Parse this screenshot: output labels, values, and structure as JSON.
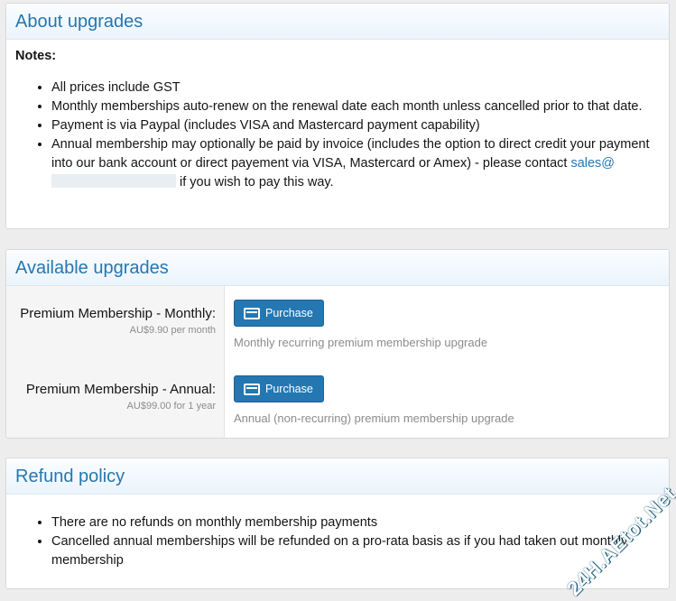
{
  "about": {
    "title": "About upgrades",
    "notes_label": "Notes:",
    "items": [
      "All prices include GST",
      "Monthly memberships auto-renew on the renewal date each month unless cancelled prior to that date.",
      "Payment is via Paypal (includes VISA and Mastercard payment capability)"
    ],
    "annual_text": "Annual membership may optionally be paid by invoice (includes the option to direct credit your payment into our bank account or direct payement via VISA, Mastercard or Amex) - please contact",
    "contact_email": "sales@",
    "annual_suffix": "if you wish to pay this way."
  },
  "available": {
    "title": "Available upgrades",
    "upgrades": [
      {
        "name": "Premium Membership - Monthly:",
        "price": "AU$9.90 per month",
        "button_label": "Purchase",
        "description": "Monthly recurring premium membership upgrade"
      },
      {
        "name": "Premium Membership - Annual:",
        "price": "AU$99.00 for 1 year",
        "button_label": "Purchase",
        "description": "Annual (non-recurring) premium membership upgrade"
      }
    ]
  },
  "refund": {
    "title": "Refund policy",
    "items": [
      "There are no refunds on monthly membership payments",
      "Cancelled annual memberships will be refunded on a pro-rata basis as if you had taken out monthly membership"
    ]
  },
  "watermark": "24H.AEtot.Net"
}
